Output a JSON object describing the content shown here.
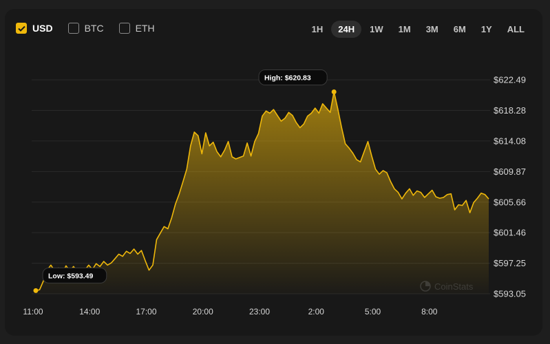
{
  "currencies": [
    {
      "label": "USD",
      "checked": true
    },
    {
      "label": "BTC",
      "checked": false
    },
    {
      "label": "ETH",
      "checked": false
    }
  ],
  "ranges": [
    {
      "label": "1H",
      "active": false
    },
    {
      "label": "24H",
      "active": true
    },
    {
      "label": "1W",
      "active": false
    },
    {
      "label": "1M",
      "active": false
    },
    {
      "label": "3M",
      "active": false
    },
    {
      "label": "6M",
      "active": false
    },
    {
      "label": "1Y",
      "active": false
    },
    {
      "label": "ALL",
      "active": false
    }
  ],
  "colors": {
    "line": "#f0b90b",
    "card": "#181818",
    "grid": "#2a2a2a",
    "tick": "#d6d6d6"
  },
  "chart_data": {
    "type": "area",
    "title": "",
    "xlabel": "",
    "ylabel": "",
    "ylim": [
      593.05,
      622.49
    ],
    "xlim": [
      0,
      24
    ],
    "x_tick_hours": [
      0,
      3,
      6,
      9,
      12,
      15,
      18,
      21
    ],
    "x_tick_labels": [
      "11:00",
      "14:00",
      "17:00",
      "20:00",
      "23:00",
      "2:00",
      "5:00",
      "8:00"
    ],
    "y_ticks": [
      622.49,
      618.28,
      614.08,
      609.87,
      605.66,
      601.46,
      597.25,
      593.05
    ],
    "y_tick_labels": [
      "$622.49",
      "$618.28",
      "$614.08",
      "$609.87",
      "$605.66",
      "$601.46",
      "$597.25",
      "$593.05"
    ],
    "grid": true,
    "series": [
      {
        "x": [
          0.0,
          0.2,
          0.4,
          0.6,
          0.8,
          1.0,
          1.2,
          1.4,
          1.6,
          1.8,
          2.0,
          2.2,
          2.4,
          2.6,
          2.8,
          3.0,
          3.2,
          3.4,
          3.6,
          3.8,
          4.0,
          4.2,
          4.4,
          4.6,
          4.8,
          5.0,
          5.2,
          5.4,
          5.6,
          5.8,
          6.0,
          6.2,
          6.4,
          6.6,
          6.8,
          7.0,
          7.2,
          7.4,
          7.6,
          7.8,
          8.0,
          8.2,
          8.4,
          8.6,
          8.8,
          9.0,
          9.2,
          9.4,
          9.6,
          9.8,
          10.0,
          10.2,
          10.4,
          10.6,
          10.8,
          11.0,
          11.2,
          11.4,
          11.6,
          11.8,
          12.0,
          12.2,
          12.4,
          12.6,
          12.8,
          13.0,
          13.2,
          13.4,
          13.6,
          13.8,
          14.0,
          14.2,
          14.4,
          14.6,
          14.8,
          15.0,
          15.2,
          15.4,
          15.6,
          15.8,
          16.0,
          16.2,
          16.4,
          16.6,
          16.8,
          17.0,
          17.2,
          17.4,
          17.6,
          17.8,
          18.0,
          18.2,
          18.4,
          18.6,
          18.8,
          19.0,
          19.2,
          19.4,
          19.6,
          19.8,
          20.0,
          20.2,
          20.4,
          20.6,
          20.8,
          21.0,
          21.2,
          21.4,
          21.6,
          21.8,
          22.0,
          22.2,
          22.4,
          22.6,
          22.8,
          23.0,
          23.2,
          23.4,
          23.6,
          23.8,
          24.0
        ],
        "values": [
          593.49,
          593.6,
          594.8,
          596.3,
          597.0,
          596.2,
          596.6,
          595.8,
          596.9,
          596.2,
          596.8,
          596.1,
          596.5,
          596.3,
          597.0,
          596.4,
          597.2,
          596.8,
          597.5,
          597.0,
          597.3,
          597.9,
          598.5,
          598.2,
          598.9,
          598.6,
          599.2,
          598.5,
          599.0,
          597.6,
          596.3,
          597.0,
          600.5,
          601.4,
          602.3,
          602.0,
          603.5,
          605.4,
          606.8,
          608.5,
          610.2,
          613.4,
          615.3,
          614.8,
          612.3,
          615.2,
          613.4,
          613.9,
          612.6,
          611.9,
          612.8,
          614.0,
          611.9,
          611.6,
          611.8,
          612.0,
          613.8,
          612.0,
          614.0,
          615.1,
          617.5,
          618.2,
          617.9,
          618.4,
          617.6,
          616.8,
          617.2,
          618.0,
          617.6,
          616.6,
          615.9,
          616.4,
          617.5,
          617.9,
          618.6,
          617.9,
          619.2,
          618.6,
          618.0,
          620.83,
          618.5,
          616.0,
          613.7,
          613.1,
          612.4,
          611.5,
          611.2,
          612.6,
          614.0,
          612.0,
          610.2,
          609.5,
          610.0,
          609.7,
          608.5,
          607.5,
          607.0,
          606.1,
          606.9,
          607.5,
          606.6,
          607.2,
          607.0,
          606.3,
          606.8,
          607.3,
          606.4,
          606.2,
          606.3,
          606.7,
          606.8,
          604.6,
          605.3,
          605.2,
          605.9,
          604.2,
          605.6,
          606.2,
          606.9,
          606.7,
          606.1
        ]
      }
    ],
    "annotations": [
      {
        "label": "High: $620.83",
        "x": 15.8,
        "y": 620.83
      },
      {
        "label": "Low: $593.49",
        "x": 0.0,
        "y": 593.49
      }
    ],
    "watermark": "CoinStats"
  }
}
